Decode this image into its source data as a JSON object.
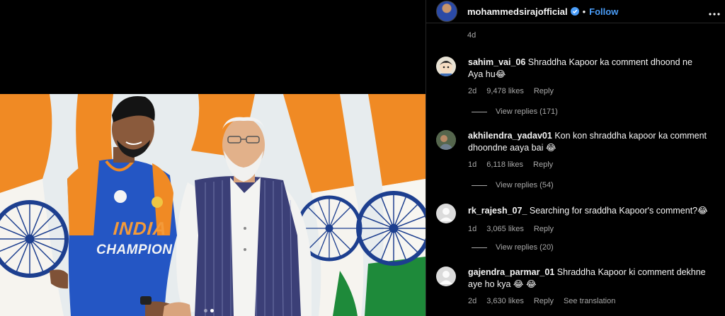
{
  "post": {
    "username": "mohammedsirajofficial",
    "follow_label": "Follow",
    "separator": "•",
    "more_icon": "more-horizontal-icon",
    "time_ago": "4d",
    "carousel_dots": 2,
    "carousel_active": 1
  },
  "comments": [
    {
      "username": "sahim_vai_06",
      "text": "Shraddha Kapoor ka comment dhoond ne Aya hu😂",
      "time": "2d",
      "likes": "9,478 likes",
      "reply_label": "Reply",
      "view_replies": "View replies (171)"
    },
    {
      "username": "akhilendra_yadav01",
      "text": "Kon kon shraddha kapoor ka comment dhoondne aaya bai 😂",
      "time": "1d",
      "likes": "6,118 likes",
      "reply_label": "Reply",
      "view_replies": "View replies (54)"
    },
    {
      "username": "rk_rajesh_07_",
      "text": "Searching for sraddha Kapoor's comment?😂",
      "time": "1d",
      "likes": "3,065 likes",
      "reply_label": "Reply",
      "view_replies": "View replies (20)"
    },
    {
      "username": "gajendra_parmar_01",
      "text": "Shraddha Kapoor ki comment dekhne aye ho kya 😂 😂",
      "time": "2d",
      "likes": "3,630 likes",
      "reply_label": "Reply",
      "see_translation": "See translation"
    }
  ],
  "jersey": {
    "line1": "INDIA",
    "line2": "CHAMPION"
  },
  "colors": {
    "saffron": "#f08a24",
    "green": "#1e8a3a",
    "chakra": "#1d3f8f",
    "jersey_blue": "#2456c4",
    "link": "#4a9df8"
  }
}
